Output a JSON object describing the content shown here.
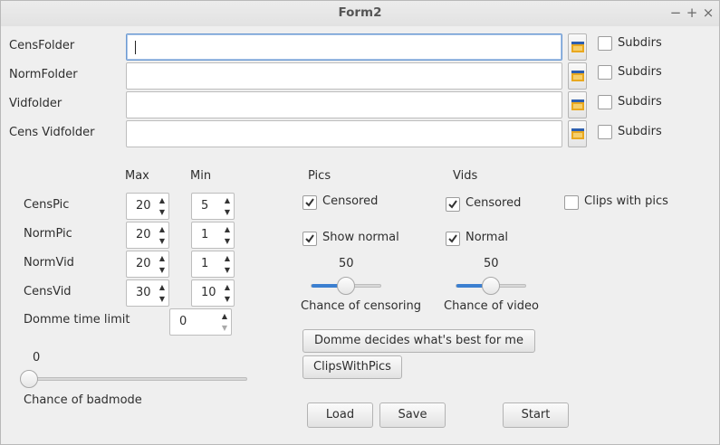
{
  "window": {
    "title": "Form2",
    "minimize": "−",
    "maximize": "+",
    "close": "×"
  },
  "folders": [
    {
      "label": "CensFolder",
      "value": "",
      "subdirs_label": "Subdirs",
      "subdirs_checked": false
    },
    {
      "label": "NormFolder",
      "value": "",
      "subdirs_label": "Subdirs",
      "subdirs_checked": false
    },
    {
      "label": "Vidfolder",
      "value": "",
      "subdirs_label": "Subdirs",
      "subdirs_checked": false
    },
    {
      "label": "Cens Vidfolder",
      "value": "",
      "subdirs_label": "Subdirs",
      "subdirs_checked": false
    }
  ],
  "limits": {
    "max_header": "Max",
    "min_header": "Min",
    "rows": [
      {
        "label": "CensPic",
        "max": "20",
        "min": "5"
      },
      {
        "label": "NormPic",
        "max": "20",
        "min": "1"
      },
      {
        "label": "NormVid",
        "max": "20",
        "min": "1"
      },
      {
        "label": "CensVid",
        "max": "30",
        "min": "10"
      }
    ],
    "domme_time_label": "Domme time limit",
    "domme_time_value": "0"
  },
  "badmode": {
    "value_label": "0",
    "value": 0,
    "label": "Chance of badmode"
  },
  "pics": {
    "header": "Pics",
    "censored_label": "Censored",
    "censored_checked": true,
    "show_normal_label": "Show normal",
    "show_normal_checked": true,
    "slider_value_label": "50",
    "slider_value": 50,
    "slider_label": "Chance of censoring"
  },
  "vids": {
    "header": "Vids",
    "censored_label": "Censored",
    "censored_checked": true,
    "normal_label": "Normal",
    "normal_checked": true,
    "slider_value_label": "50",
    "slider_value": 50,
    "slider_label": "Chance of video"
  },
  "clips_with_pics": {
    "label": "Clips with pics",
    "checked": false
  },
  "buttons": {
    "domme_decides": "Domme decides what's best for me",
    "clips_with_pics": "ClipsWithPics",
    "load": "Load",
    "save": "Save",
    "start": "Start"
  },
  "colors": {
    "accent": "#3b7fd0",
    "background": "#efefef"
  }
}
